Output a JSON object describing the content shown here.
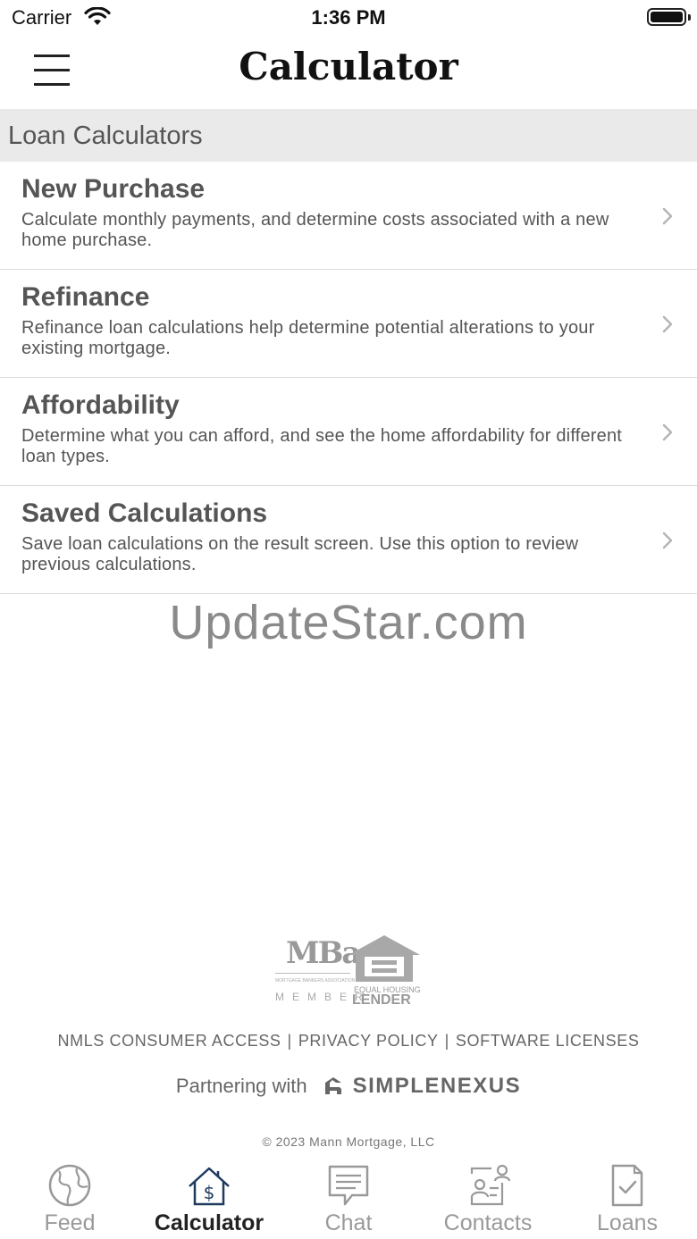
{
  "status_bar": {
    "carrier": "Carrier",
    "time": "1:36 PM",
    "wifi_icon": "wifi-icon",
    "battery_icon": "battery-icon"
  },
  "header": {
    "title": "Calculator",
    "menu_icon": "hamburger-menu-icon"
  },
  "section": {
    "title": "Loan Calculators"
  },
  "calculators": [
    {
      "title": "New Purchase",
      "description": "Calculate monthly payments, and determine costs associated with a new home purchase."
    },
    {
      "title": "Refinance",
      "description": "Refinance loan calculations help determine potential alterations to your existing mortgage."
    },
    {
      "title": "Affordability",
      "description": "Determine what you can afford, and see the home affordability for different loan types."
    },
    {
      "title": "Saved Calculations",
      "description": "Save loan calculations on the result screen. Use this option to review previous calculations."
    }
  ],
  "watermark": "UpdateStar.com",
  "logos": {
    "mba": {
      "letters": "MBa",
      "subtitle": "MORTGAGE BANKERS ASSOCIATION",
      "member": "MEMBER"
    },
    "equal_housing": {
      "line1": "EQUAL HOUSING",
      "line2": "LENDER"
    }
  },
  "footer": {
    "links": [
      "NMLS CONSUMER ACCESS",
      "PRIVACY POLICY",
      "SOFTWARE LICENSES"
    ],
    "separator": "|",
    "partnering_text": "Partnering with",
    "partner_name": "SIMPLENEXUS",
    "copyright": "© 2023 Mann Mortgage, LLC"
  },
  "tabs": [
    {
      "label": "Feed",
      "icon": "globe-icon",
      "active": false
    },
    {
      "label": "Calculator",
      "icon": "house-dollar-icon",
      "active": true
    },
    {
      "label": "Chat",
      "icon": "chat-bubble-icon",
      "active": false
    },
    {
      "label": "Contacts",
      "icon": "contacts-icon",
      "active": false
    },
    {
      "label": "Loans",
      "icon": "document-check-icon",
      "active": false
    }
  ],
  "colors": {
    "active_tab_icon": "#1f3a5f",
    "inactive": "#999999",
    "section_bg": "#eaeaea"
  }
}
